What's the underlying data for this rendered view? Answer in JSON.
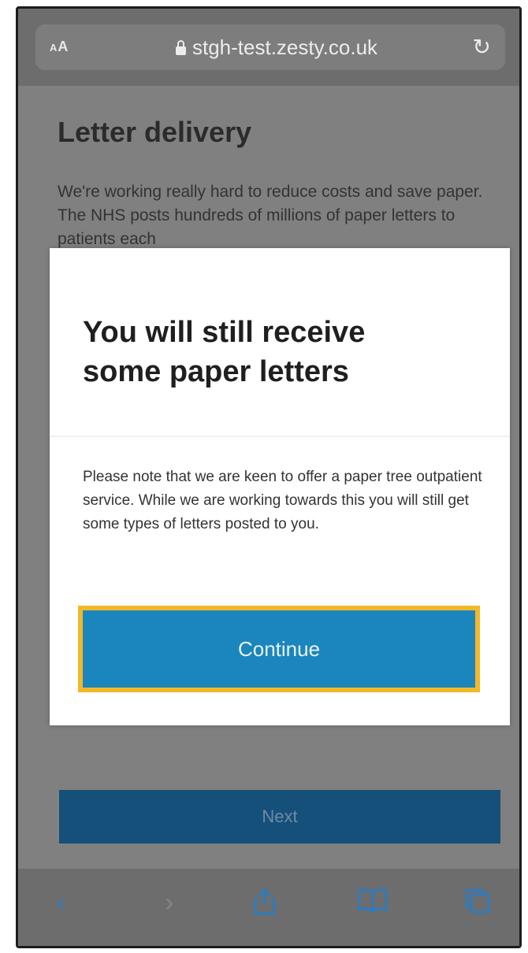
{
  "browser": {
    "text_size_label": "AA",
    "url": "stgh-test.zesty.co.uk"
  },
  "page": {
    "title": "Letter delivery",
    "intro": "We're working really hard to reduce costs and save paper. The NHS posts hundreds of millions of paper letters to patients each",
    "next_label": "Next"
  },
  "modal": {
    "title": "You will still receive some paper letters",
    "body": "Please note that we are keen to offer a paper tree outpatient service. While we are working towards this you will still get some types of letters posted to you.",
    "continue_label": "Continue"
  },
  "toolbar": {
    "icons": [
      "back-icon",
      "forward-icon",
      "share-icon",
      "bookmarks-icon",
      "tabs-icon"
    ]
  },
  "colors": {
    "primary_button": "#1b86bd",
    "focus_ring": "#f2b829",
    "next_button": "#14507a"
  }
}
